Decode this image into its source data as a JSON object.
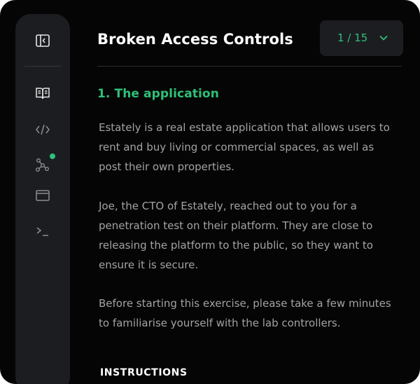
{
  "header": {
    "title": "Broken Access Controls",
    "pager": {
      "label": "1 / 15"
    }
  },
  "sidebar": {
    "items": [
      {
        "name": "collapse-sidebar",
        "icon": "sidebar-collapse-icon"
      },
      {
        "name": "book",
        "icon": "book-icon"
      },
      {
        "name": "code",
        "icon": "code-icon"
      },
      {
        "name": "network",
        "icon": "network-icon",
        "badge": true
      },
      {
        "name": "browser",
        "icon": "browser-window-icon"
      },
      {
        "name": "terminal",
        "icon": "terminal-icon"
      }
    ]
  },
  "content": {
    "section_title": "1. The application",
    "paragraphs": [
      "Estately is a real estate application that allows users to rent and buy living or commercial spaces, as well as post their own properties.",
      "Joe, the CTO of Estately, reached out to you for a penetration test on their platform. They are close to releasing the platform to the public, so they want to ensure it is secure.",
      "Before starting this exercise, please take a few minutes to familiarise yourself with the lab controllers."
    ],
    "instructions_heading": "INSTRUCTIONS"
  },
  "colors": {
    "accent": "#2fc07a",
    "background": "#050505",
    "sidebar": "#1c1d21",
    "text_muted": "#a3a3a3",
    "icon": "#8b8d93"
  }
}
